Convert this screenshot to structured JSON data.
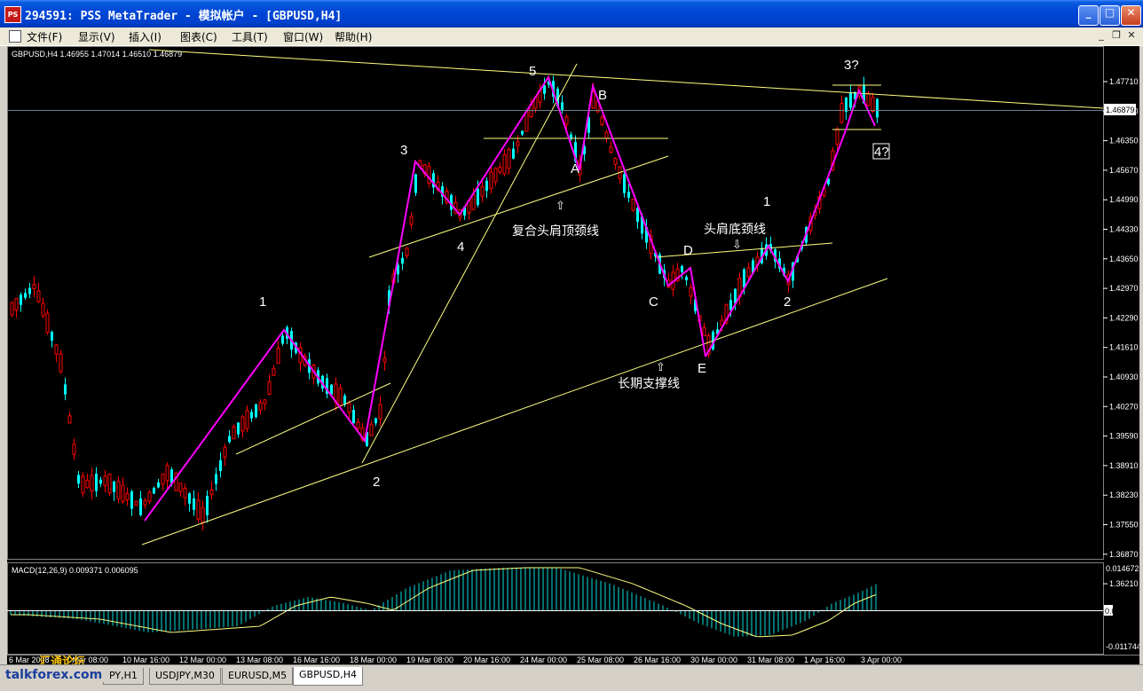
{
  "window": {
    "title": "294591: PSS MetaTrader - 模拟帐户 - [GBPUSD,H4]",
    "icon_text": "PS"
  },
  "menu": [
    "文件(F)",
    "显示(V)",
    "插入(I)",
    "图表(C)",
    "工具(T)",
    "窗口(W)",
    "帮助(H)"
  ],
  "chart": {
    "symbol_info": "GBPUSD,H4  1.46955 1.47014 1.46510 1.46879",
    "current_price": "1.46879",
    "price_ticks": [
      "1.47710",
      "1.47030",
      "1.46350",
      "1.45670",
      "1.44990",
      "1.44330",
      "1.43650",
      "1.42970",
      "1.42290",
      "1.41610",
      "1.40930",
      "1.40270",
      "1.39590",
      "1.38910",
      "1.38230",
      "1.37550",
      "1.36870",
      "1.36210"
    ],
    "time_ticks": [
      "6 Mar 2008",
      "7 Mar 08:00",
      "10 Mar 16:00",
      "12 Mar 00:00",
      "13 Mar 08:00",
      "16 Mar 16:00",
      "18 Mar 00:00",
      "19 Mar 08:00",
      "20 Mar 16:00",
      "24 Mar 00:00",
      "25 Mar 08:00",
      "26 Mar 16:00",
      "30 Mar 00:00",
      "31 Mar 08:00",
      "1 Apr 16:00",
      "3 Apr 00:00"
    ],
    "wave_labels_left": [
      "1",
      "2",
      "3",
      "4",
      "5"
    ],
    "wave_labels_abc": [
      "A",
      "B",
      "C",
      "D",
      "E"
    ],
    "wave_labels_right": [
      "1",
      "2",
      "3?",
      "4?"
    ],
    "annotations": {
      "top_neckline": "复合头肩顶颈线",
      "bottom_neckline": "头肩底颈线",
      "support": "长期支撑线",
      "arrow_up": "⇧",
      "arrow_down": "⇩"
    },
    "macd": {
      "label": "MACD(12,26,9) 0.009371 0.006095",
      "ticks": [
        "0.014672",
        "0.00",
        "-0.011744"
      ]
    },
    "colors": {
      "bull": "#00ffff",
      "bear": "#ff0000",
      "wave": "#ff00ff",
      "trend": "#ffff80",
      "macd_hist": "#00e0e0",
      "macd_signal": "#ffff80"
    }
  },
  "tabs": [
    "PY,H1",
    "USDJPY,M30",
    "EURUSD,M5",
    "GBPUSD,H4"
  ],
  "watermark": {
    "site": "talkforex.com",
    "cn": "汇通论坛"
  }
}
